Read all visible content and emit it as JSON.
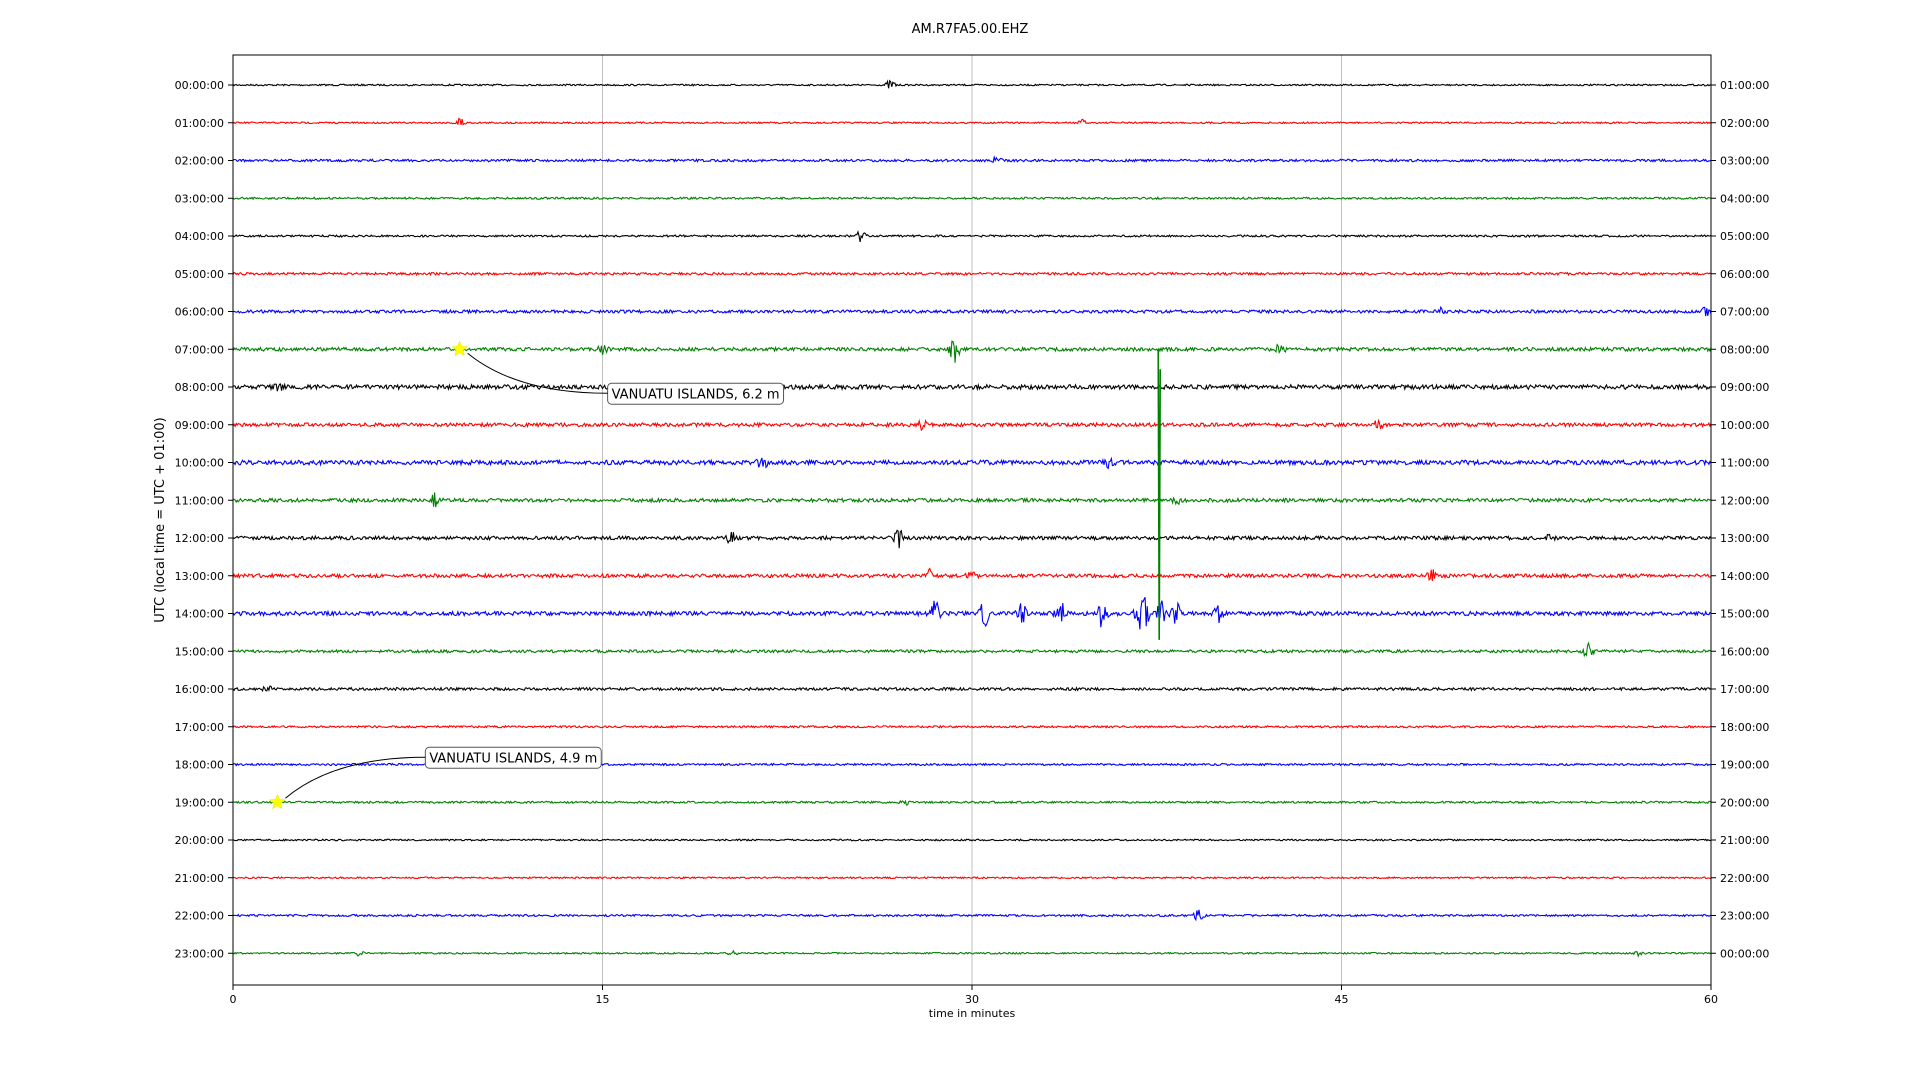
{
  "chart_data": {
    "type": "line",
    "title": "AM.R7FA5.00.EHZ",
    "xlabel": "time in minutes",
    "ylabel": "UTC (local time = UTC + 01:00)",
    "xlim": [
      0,
      60
    ],
    "xticks": [
      0,
      15,
      30,
      45,
      60
    ],
    "grid": "vertical",
    "colors": [
      "#000000",
      "#ff0000",
      "#0000ff",
      "#008000"
    ],
    "rows": [
      {
        "left": "00:00:00",
        "right": "01:00:00",
        "amp": 0.8,
        "bursts": [
          [
            26.7,
            5
          ]
        ]
      },
      {
        "left": "01:00:00",
        "right": "02:00:00",
        "amp": 0.8,
        "bursts": [
          [
            9.2,
            6
          ],
          [
            34.5,
            3
          ]
        ]
      },
      {
        "left": "02:00:00",
        "right": "03:00:00",
        "amp": 1.2,
        "bursts": [
          [
            31,
            3
          ]
        ]
      },
      {
        "left": "03:00:00",
        "right": "04:00:00",
        "amp": 1.0,
        "bursts": []
      },
      {
        "left": "04:00:00",
        "right": "05:00:00",
        "amp": 1.0,
        "bursts": [
          [
            25.5,
            6
          ]
        ]
      },
      {
        "left": "05:00:00",
        "right": "06:00:00",
        "amp": 1.2,
        "bursts": []
      },
      {
        "left": "06:00:00",
        "right": "07:00:00",
        "amp": 1.5,
        "bursts": [
          [
            49,
            3
          ],
          [
            59.8,
            4
          ]
        ]
      },
      {
        "left": "07:00:00",
        "right": "08:00:00",
        "amp": 1.8,
        "bursts": [
          [
            29.3,
            14
          ],
          [
            42.5,
            5
          ],
          [
            15,
            4
          ]
        ]
      },
      {
        "left": "08:00:00",
        "right": "09:00:00",
        "amp": 2.2,
        "bursts": [
          [
            1.8,
            4
          ]
        ]
      },
      {
        "left": "09:00:00",
        "right": "10:00:00",
        "amp": 1.8,
        "bursts": [
          [
            28,
            4
          ],
          [
            46.5,
            4
          ]
        ]
      },
      {
        "left": "10:00:00",
        "right": "11:00:00",
        "amp": 2.2,
        "bursts": [
          [
            21.5,
            6
          ],
          [
            35.5,
            5
          ]
        ]
      },
      {
        "left": "11:00:00",
        "right": "12:00:00",
        "amp": 1.8,
        "bursts": [
          [
            8.2,
            6
          ],
          [
            38.3,
            5
          ]
        ]
      },
      {
        "left": "12:00:00",
        "right": "13:00:00",
        "amp": 1.8,
        "bursts": [
          [
            20.2,
            9
          ],
          [
            27,
            9
          ],
          [
            53.5,
            4
          ]
        ]
      },
      {
        "left": "13:00:00",
        "right": "14:00:00",
        "amp": 1.8,
        "bursts": [
          [
            28.3,
            6
          ],
          [
            30,
            4
          ],
          [
            48.7,
            5
          ]
        ]
      },
      {
        "left": "14:00:00",
        "right": "15:00:00",
        "amp": 2.0,
        "bursts": [
          [
            28.5,
            12
          ],
          [
            30.5,
            12
          ],
          [
            32,
            10
          ],
          [
            33.6,
            12
          ],
          [
            35.3,
            14
          ],
          [
            36.8,
            12
          ],
          [
            37,
            14
          ],
          [
            37.7,
            12
          ],
          [
            38.3,
            10
          ],
          [
            40,
            8
          ]
        ]
      },
      {
        "left": "15:00:00",
        "right": "16:00:00",
        "amp": 1.4,
        "bursts": [
          [
            55,
            7
          ]
        ]
      },
      {
        "left": "16:00:00",
        "right": "17:00:00",
        "amp": 1.4,
        "bursts": [
          [
            1.4,
            4
          ]
        ]
      },
      {
        "left": "17:00:00",
        "right": "18:00:00",
        "amp": 1.0,
        "bursts": []
      },
      {
        "left": "18:00:00",
        "right": "19:00:00",
        "amp": 1.0,
        "bursts": []
      },
      {
        "left": "19:00:00",
        "right": "20:00:00",
        "amp": 1.0,
        "bursts": [
          [
            27.3,
            3
          ]
        ]
      },
      {
        "left": "20:00:00",
        "right": "21:00:00",
        "amp": 0.8,
        "bursts": []
      },
      {
        "left": "21:00:00",
        "right": "22:00:00",
        "amp": 0.8,
        "bursts": []
      },
      {
        "left": "22:00:00",
        "right": "23:00:00",
        "amp": 1.0,
        "bursts": [
          [
            39.2,
            5
          ]
        ]
      },
      {
        "left": "23:00:00",
        "right": "00:00:00",
        "amp": 0.8,
        "bursts": [
          [
            5.1,
            3
          ],
          [
            20.2,
            3
          ],
          [
            57,
            4
          ]
        ]
      }
    ],
    "spike": {
      "row": 7,
      "minute": 37.6,
      "top_row": 7,
      "bottom_row": 14.7
    },
    "events": [
      {
        "row": 7,
        "minute": 9.2,
        "label": "VANUATU ISLANDS, 6.2 m"
      },
      {
        "row": 19,
        "minute": 1.8,
        "label": "VANUATU ISLANDS, 4.9 m"
      }
    ],
    "marker_color": "#ffff00"
  }
}
